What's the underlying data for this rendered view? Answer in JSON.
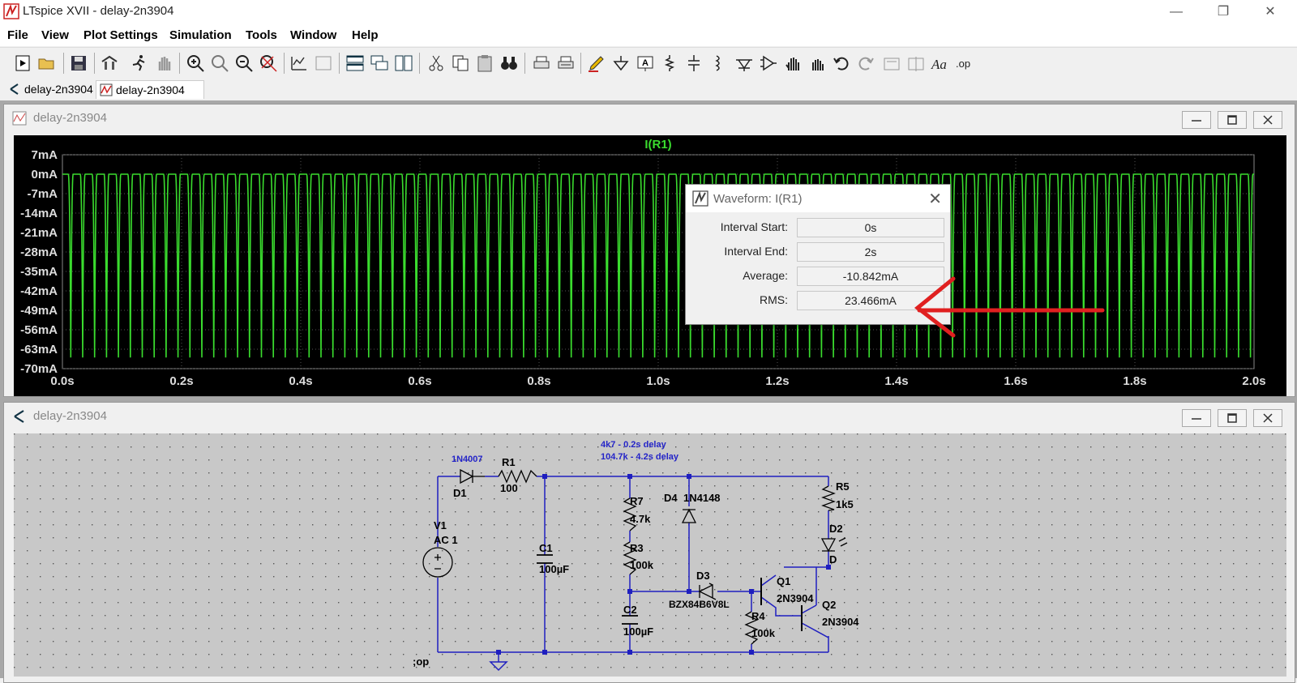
{
  "window": {
    "title": "LTspice XVII - delay-2n3904"
  },
  "menu": [
    "File",
    "View",
    "Plot Settings",
    "Simulation",
    "Tools",
    "Window",
    "Help"
  ],
  "tabs": [
    {
      "label": "delay-2n3904",
      "kind": "schematic"
    },
    {
      "label": "delay-2n3904",
      "kind": "waveform"
    }
  ],
  "plot_window": {
    "title": "delay-2n3904"
  },
  "schematic_window": {
    "title": "delay-2n3904"
  },
  "colors": {
    "trace": "#3adc2e",
    "axis_text": "#dddddd",
    "title_text": "#3adc2e",
    "wire": "#1f1fbf",
    "annotation": "#2424c8",
    "arrow": "#e02020"
  },
  "chart_data": {
    "type": "line",
    "title": "I(R1)",
    "xlabel": "",
    "ylabel": "",
    "x_ticks": [
      "0.0s",
      "0.2s",
      "0.4s",
      "0.6s",
      "0.8s",
      "1.0s",
      "1.2s",
      "1.4s",
      "1.6s",
      "1.8s",
      "2.0s"
    ],
    "y_ticks": [
      "7mA",
      "0mA",
      "-7mA",
      "-14mA",
      "-21mA",
      "-28mA",
      "-35mA",
      "-42mA",
      "-49mA",
      "-56mA",
      "-63mA",
      "-70mA"
    ],
    "xlim": [
      0,
      2
    ],
    "ylim": [
      -70,
      7
    ],
    "grid": true,
    "series": [
      {
        "name": "I(R1)",
        "waveform": "periodic half-wave pulses",
        "period_s": 0.02,
        "high_mA": 0,
        "low_mA": -66
      }
    ]
  },
  "dialog": {
    "title": "Waveform: I(R1)",
    "rows": [
      {
        "label": "Interval Start:",
        "value": "0s"
      },
      {
        "label": "Interval End:",
        "value": "2s"
      },
      {
        "label": "Average:",
        "value": "-10.842mA"
      },
      {
        "label": "RMS:",
        "value": "23.466mA"
      }
    ]
  },
  "schematic": {
    "notes": [
      "4k7 - 0.2s delay",
      "104.7k - 4.2s delay"
    ],
    "components": [
      {
        "ref": "D1",
        "value": "1N4007"
      },
      {
        "ref": "R1",
        "value": "100"
      },
      {
        "ref": "V1",
        "value": "AC 1"
      },
      {
        "ref": "C1",
        "value": "100µF"
      },
      {
        "ref": "R7",
        "value": "4.7k"
      },
      {
        "ref": "R3",
        "value": "100k"
      },
      {
        "ref": "D4",
        "value": "1N4148"
      },
      {
        "ref": "D3",
        "value": "BZX84B6V8L"
      },
      {
        "ref": "C2",
        "value": "100µF"
      },
      {
        "ref": "R4",
        "value": "100k"
      },
      {
        "ref": "Q1",
        "value": "2N3904"
      },
      {
        "ref": "Q2",
        "value": "2N3904"
      },
      {
        "ref": "R5",
        "value": "1k5"
      },
      {
        "ref": "D2",
        "value": "D"
      }
    ],
    "directive": ";op"
  }
}
